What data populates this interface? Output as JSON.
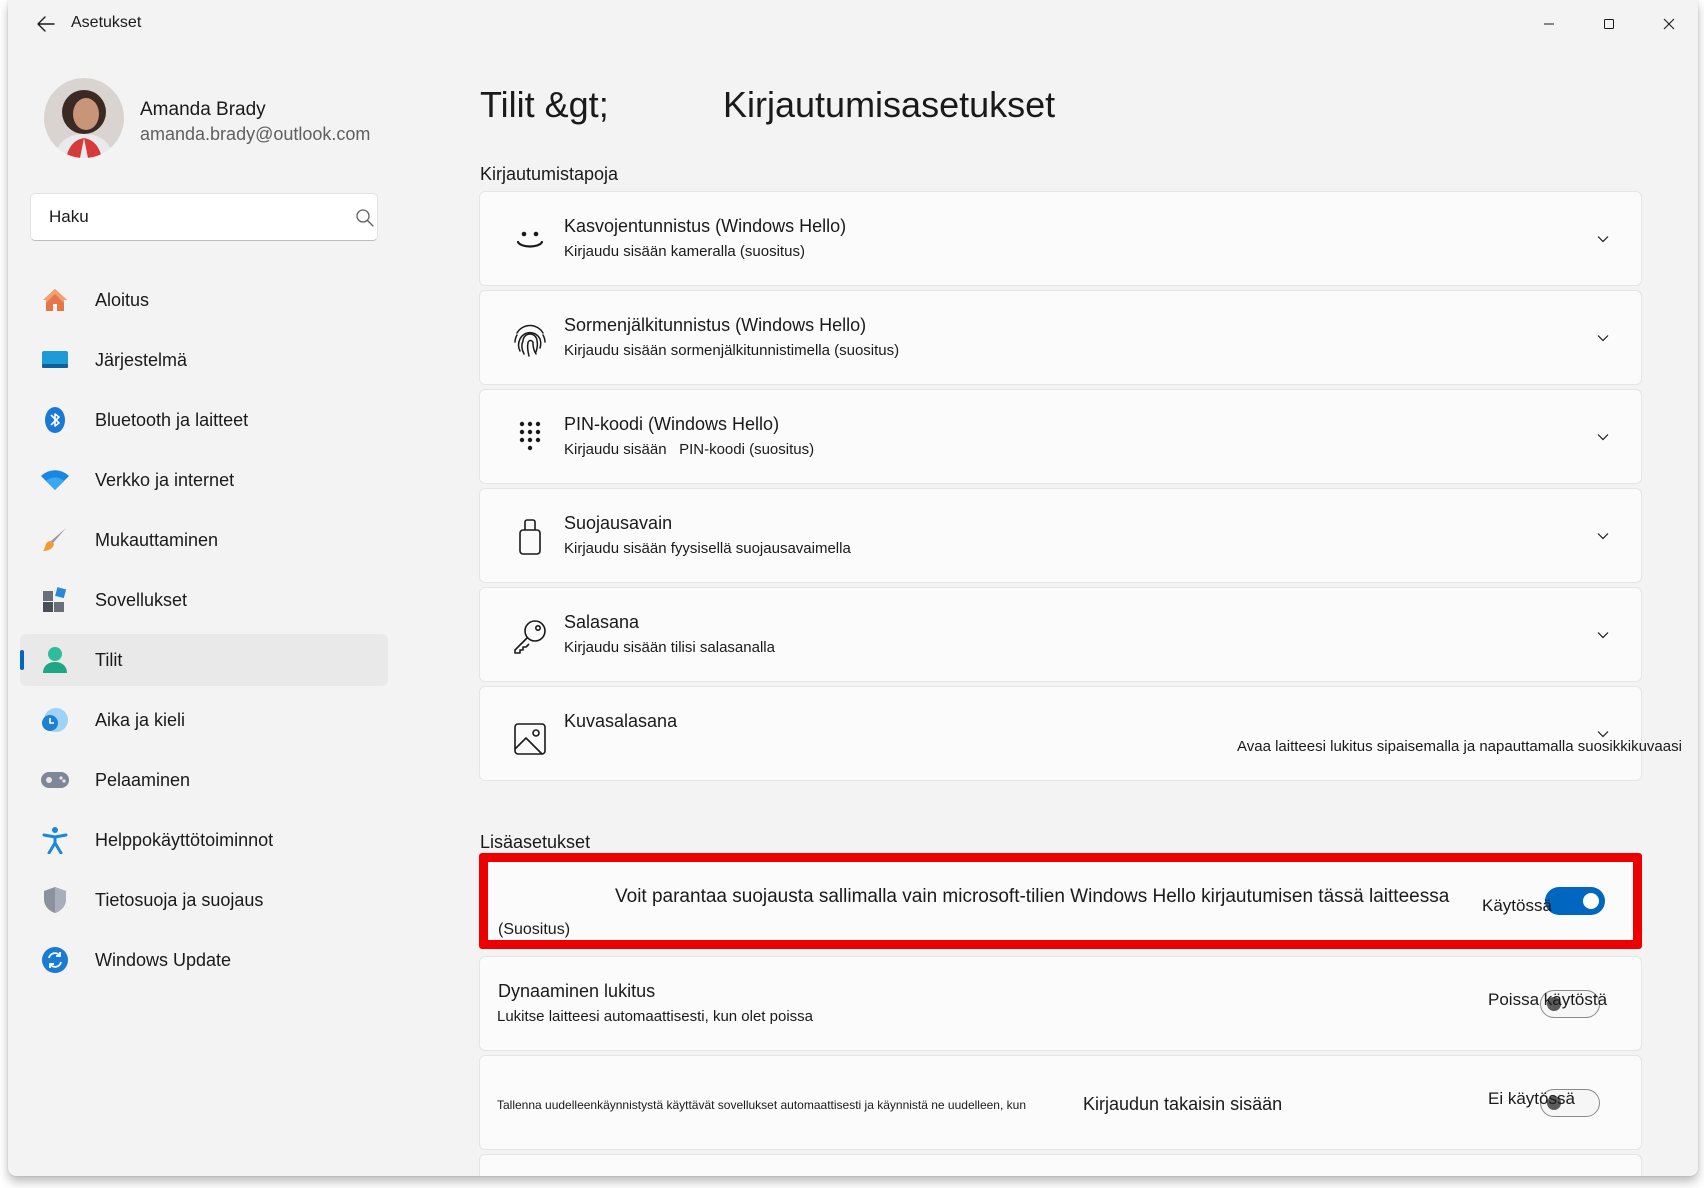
{
  "window": {
    "title": "Asetukset"
  },
  "profile": {
    "name": "Amanda Brady",
    "email": "amanda.brady@outlook.com"
  },
  "search": {
    "placeholder": "Haku"
  },
  "nav": {
    "items": [
      {
        "label": "Aloitus",
        "icon": "home-icon"
      },
      {
        "label": "Järjestelmä",
        "icon": "system-icon"
      },
      {
        "label": "Bluetooth ja laitteet",
        "icon": "bluetooth-icon"
      },
      {
        "label": "Verkko ja internet",
        "icon": "wifi-icon"
      },
      {
        "label": "Mukauttaminen",
        "icon": "brush-icon"
      },
      {
        "label": "Sovellukset",
        "icon": "apps-icon"
      },
      {
        "label": "Tilit",
        "icon": "account-icon",
        "active": true
      },
      {
        "label": "Aika ja kieli",
        "icon": "time-language-icon"
      },
      {
        "label": "Pelaaminen",
        "icon": "gamepad-icon"
      },
      {
        "label": "Helppokäyttötoiminnot",
        "icon": "accessibility-icon"
      },
      {
        "label": "Tietosuoja ja suojaus",
        "icon": "shield-icon"
      },
      {
        "label": "Windows Update",
        "icon": "update-icon"
      }
    ]
  },
  "header": {
    "breadcrumb_parent": "Tilit &gt;",
    "title": "Kirjautumisasetukset"
  },
  "sections": {
    "sign_in_methods": "Kirjautumistapoja",
    "additional": "Lisäasetukset"
  },
  "methods": [
    {
      "title": "Kasvojentunnistus (Windows Hello)",
      "desc": "Kirjaudu sisään kameralla (suositus)",
      "icon": "face-icon"
    },
    {
      "title": "Sormenjälkitunnistus (Windows Hello)",
      "desc": "Kirjaudu sisään sormenjälkitunnistimella (suositus)",
      "icon": "fingerprint-icon"
    },
    {
      "title": "PIN-koodi (Windows Hello)",
      "desc": "Kirjaudu sisään   PIN-koodi (suositus)",
      "icon": "pin-keypad-icon"
    },
    {
      "title": "Suojausavain",
      "desc": "Kirjaudu sisään fyysisellä suojausavaimella",
      "icon": "security-key-icon"
    },
    {
      "title": "Salasana",
      "desc": "Kirjaudu sisään tilisi salasanalla",
      "icon": "key-icon"
    },
    {
      "title": "Kuvasalasana",
      "desc": "Avaa laitteesi lukitus sipaisemalla ja napauttamalla suosikkikuvaasi",
      "icon": "picture-icon"
    }
  ],
  "hello_only": {
    "title": "Voit parantaa suojausta sallimalla vain microsoft-tilien Windows Hello kirjautumisen tässä laitteessa",
    "note": "(Suositus)",
    "state_label": "Käytössä",
    "on": true
  },
  "dynamic_lock": {
    "title": "Dynaaminen lukitus",
    "desc": "Lukitse laitteesi automaattisesti, kun olet poissa",
    "state_label": "Poissa käytöstä",
    "on": false
  },
  "restart_apps": {
    "desc": "Tallenna uudelleenkäynnistystä käyttävät sovellukset automaattisesti ja käynnistä ne uudelleen, kun",
    "desc2": "Kirjaudun takaisin sisään",
    "state_label": "Ei käytössä",
    "on": false
  },
  "colors": {
    "accent": "#0067c0",
    "highlight": "#ee0000",
    "window_bg": "#f3f3f3"
  }
}
